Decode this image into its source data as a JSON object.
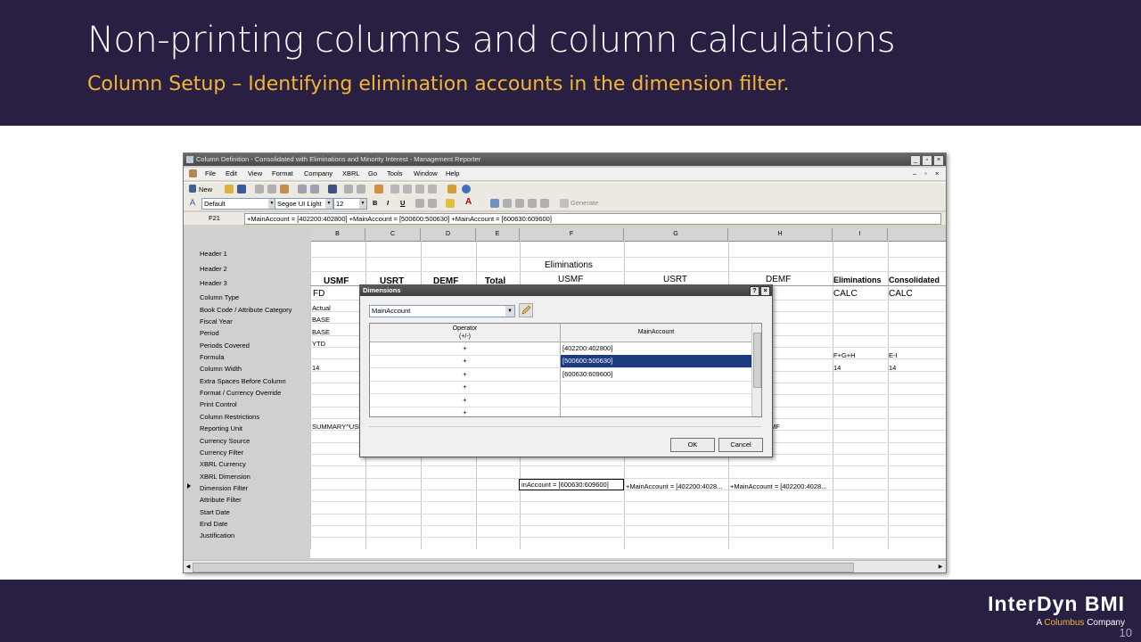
{
  "slide": {
    "title": "Non-printing columns and column calculations",
    "subtitle": "Column Setup – Identifying elimination accounts in the dimension filter.",
    "logo_main": "InterDyn BMI",
    "logo_sub_prefix": "A ",
    "logo_sub_brand": "Columbus",
    "logo_sub_suffix": " Company",
    "page_number": "10"
  },
  "window": {
    "title": "Column Definition - Consolidated with Eliminations and Minority Interest - Management Reporter",
    "menu": [
      "File",
      "Edit",
      "View",
      "Format",
      "Company",
      "XBRL",
      "Go",
      "Tools",
      "Window",
      "Help"
    ],
    "new_label": "New",
    "style_combo": "Default",
    "font_combo": "Segoe UI Light",
    "size_combo": "12",
    "generate_label": "Generate",
    "cell_ref": "F21",
    "formula": "+MainAccount = [402200:402800] +MainAccount = [500600:500630] +MainAccount = [600630:609600]"
  },
  "grid": {
    "columns": [
      "B",
      "C",
      "D",
      "E",
      "F",
      "G",
      "H",
      "I"
    ],
    "row_labels": [
      "Header 1",
      "Header 2",
      "Header 3",
      "Column Type",
      "Book Code / Attribute Category",
      "Fiscal Year",
      "Period",
      "Periods Covered",
      "Formula",
      "Column Width",
      "Extra Spaces Before Column",
      "Format / Currency Override",
      "Print Control",
      "Column Restrictions",
      "Reporting Unit",
      "Currency Source",
      "Currency Filter",
      "XBRL Currency",
      "XBRL Dimension",
      "Dimension Filter",
      "Attribute Filter",
      "Start Date",
      "End Date",
      "Justification"
    ],
    "header2_F": "Eliminations",
    "header3": {
      "B": "USMF",
      "C": "USRT",
      "D": "DEMF",
      "E": "Total",
      "F": "USMF",
      "G": "USRT",
      "H": "DEMF",
      "I": "Eliminations",
      "J": "Consolidated"
    },
    "col_type_B": "FD",
    "col_type_I": "CALC",
    "col_type_J": "CALC",
    "book_code_B": "Actual",
    "fiscal_year_B": "BASE",
    "period_B": "BASE",
    "periods_covered_B": "YTD",
    "formula_I": "F+G+H",
    "formula_J": "E-I",
    "width_B": "14",
    "width_I": "14",
    "width_J": "14",
    "reporting_unit_B": "SUMMARY^USM",
    "reporting_unit_H": "MF",
    "dimfilter_F": "inAccount = [600630:609600]",
    "dimfilter_G": "+MainAccount = [402200:4028...",
    "dimfilter_H": "+MainAccount = [402200:4028..."
  },
  "dialog": {
    "title": "Dimensions",
    "dimension_combo": "MainAccount",
    "col_operator": "Operator\n(+/-)",
    "col_operator_l1": "Operator",
    "col_operator_l2": "(+/-)",
    "col_account": "MainAccount",
    "rows": [
      {
        "op": "+",
        "account": "[402200:402800]",
        "selected": false
      },
      {
        "op": "+",
        "account": "[500600:500630]",
        "selected": true
      },
      {
        "op": "+",
        "account": "[600630:609600]",
        "selected": false
      },
      {
        "op": "+",
        "account": "",
        "selected": false
      },
      {
        "op": "+",
        "account": "",
        "selected": false
      },
      {
        "op": "+",
        "account": "",
        "selected": false
      }
    ],
    "ok_label": "OK",
    "cancel_label": "Cancel"
  }
}
